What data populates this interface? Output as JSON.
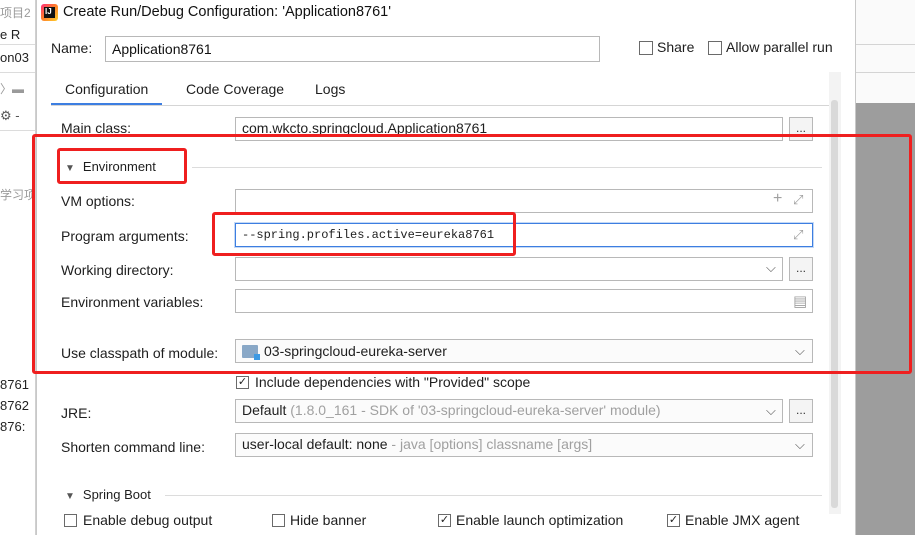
{
  "background": {
    "left_texts": [
      "项目2",
      "e  R",
      "on03",
      "学习项",
      "8761",
      "8762",
      "876:"
    ]
  },
  "dialog": {
    "title": "Create Run/Debug Configuration: 'Application8761'",
    "app_icon_text": "IJ",
    "close_glyph": "✕",
    "name_label": "Name:",
    "name_value": "Application8761",
    "share_label": "Share",
    "allow_parallel_label": "Allow parallel run",
    "tabs": [
      "Configuration",
      "Code Coverage",
      "Logs"
    ],
    "active_tab": "Configuration"
  },
  "config": {
    "main_class_label": "Main class:",
    "main_class_value": "com.wkcto.springcloud.Application8761",
    "environment_label": "Environment",
    "vm_options_label": "VM options:",
    "vm_options_value": "",
    "program_args_label": "Program arguments:",
    "program_args_value": "--spring.profiles.active=eureka8761",
    "working_dir_label": "Working directory:",
    "working_dir_value": "",
    "env_vars_label": "Environment variables:",
    "env_vars_value": "",
    "classpath_label": "Use classpath of module:",
    "classpath_value": "03-springcloud-eureka-server",
    "include_deps_label": "Include dependencies with \"Provided\" scope",
    "include_deps_checked": true,
    "jre_label": "JRE:",
    "jre_value": "Default",
    "jre_hint": "(1.8.0_161 - SDK of '03-springcloud-eureka-server' module)",
    "shorten_label": "Shorten command line:",
    "shorten_value": "user-local default: none",
    "shorten_hint": " - java [options] classname [args]",
    "spring_boot_label": "Spring Boot",
    "enable_debug_label": "Enable debug output",
    "hide_banner_label": "Hide banner",
    "enable_launch_opt_label": "Enable launch optimization",
    "enable_jmx_label": "Enable JMX agent",
    "enable_debug_checked": false,
    "hide_banner_checked": false,
    "enable_launch_opt_checked": true,
    "enable_jmx_checked": true
  },
  "glyphs": {
    "dots": "...",
    "chevron": "⌵",
    "plus": "+",
    "expand": "⤢",
    "doc": "▤",
    "triangle_down": "▼",
    "check": "✓"
  },
  "colors": {
    "accent": "#3d7ee1",
    "highlight_red": "#ef1f1f"
  }
}
